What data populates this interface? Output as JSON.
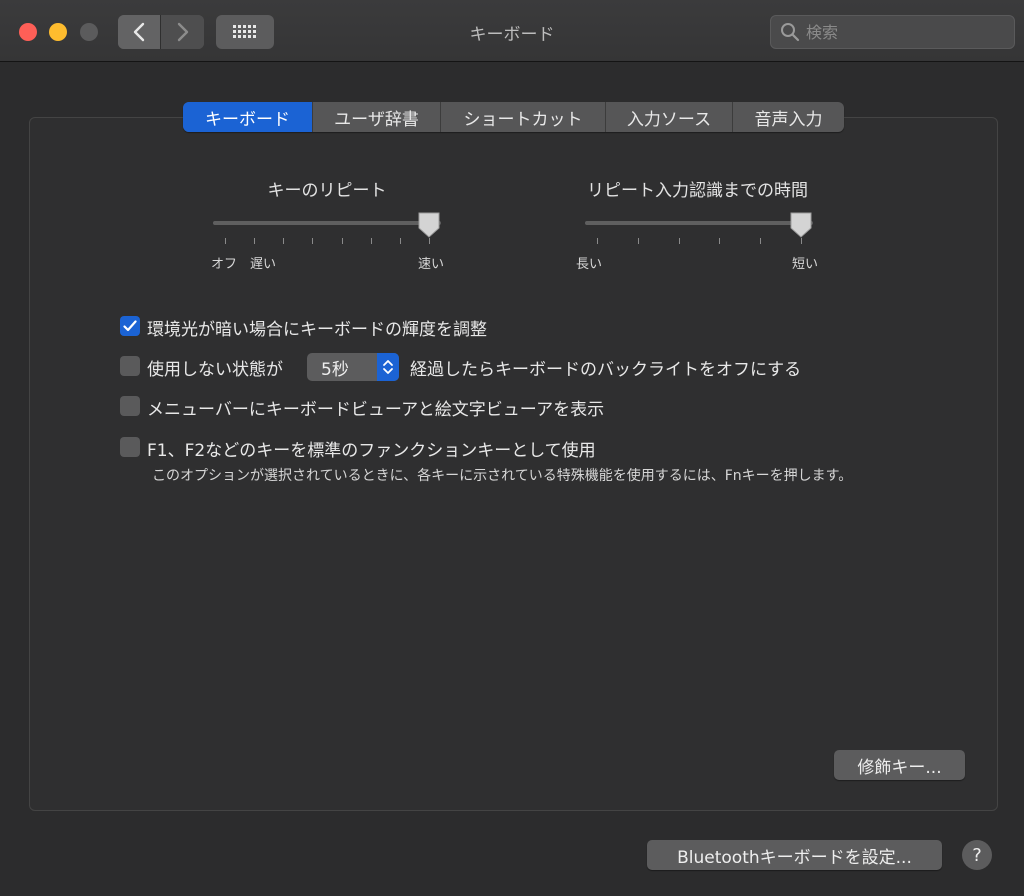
{
  "window": {
    "title": "キーボード"
  },
  "search": {
    "placeholder": "検索",
    "icon": "magnifier-icon"
  },
  "tabs": [
    {
      "label": "キーボード",
      "active": true
    },
    {
      "label": "ユーザ辞書",
      "active": false
    },
    {
      "label": "ショートカット",
      "active": false
    },
    {
      "label": "入力ソース",
      "active": false
    },
    {
      "label": "音声入力",
      "active": false
    }
  ],
  "key_repeat": {
    "title": "キーのリピート",
    "label_off": "オフ",
    "label_slow": "遅い",
    "label_fast": "速い",
    "value_fraction": 1.0
  },
  "repeat_delay": {
    "title": "リピート入力認識までの時間",
    "label_long": "長い",
    "label_short": "短い",
    "value_fraction": 1.0
  },
  "options": {
    "brightness": {
      "label": "環境光が暗い場合にキーボードの輝度を調整",
      "checked": true
    },
    "backlight": {
      "label_before": "使用しない状態が",
      "popup_value": "5秒",
      "label_after": "経過したらキーボードのバックライトをオフにする",
      "checked": false
    },
    "viewer": {
      "label": "メニューバーにキーボードビューアと絵文字ビューアを表示",
      "checked": false
    },
    "fn_keys": {
      "label": "F1、F2などのキーを標準のファンクションキーとして使用",
      "note": "このオプションが選択されているときに、各キーに示されている特殊機能を使用するには、Fnキーを押します。",
      "checked": false
    }
  },
  "buttons": {
    "modifier": "修飾キー...",
    "bluetooth": "Bluetoothキーボードを設定...",
    "help": "?"
  },
  "colors": {
    "accent": "#1b63d4",
    "background": "#2c2c2d"
  }
}
